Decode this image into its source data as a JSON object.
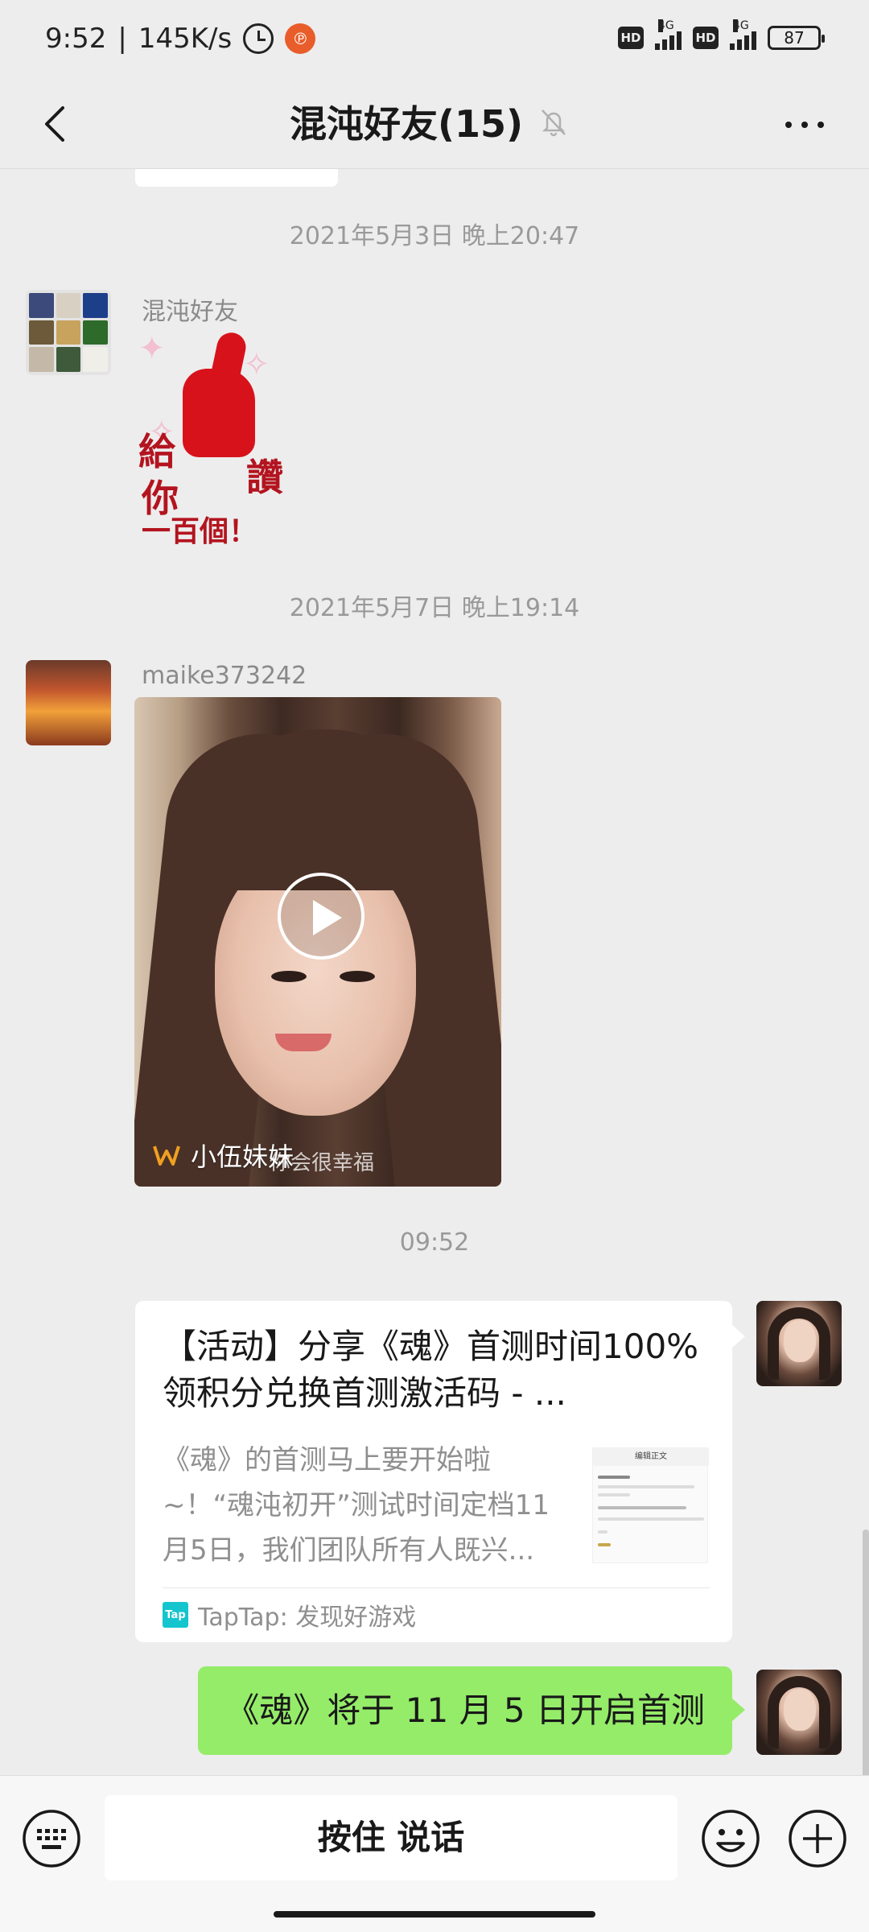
{
  "status_bar": {
    "time": "9:52",
    "speed": "145K/s",
    "app_badge": "℗",
    "hd1": "HD",
    "net1": "4G",
    "hd2": "HD",
    "net2": "4G",
    "battery": "87"
  },
  "nav": {
    "title": "混沌好友(15)"
  },
  "messages": {
    "ts1": "2021年5月3日 晚上20:47",
    "sender1": "混沌好友",
    "sticker": {
      "line1": "給",
      "line2": "你",
      "line3": "讚",
      "line4": "一百個！"
    },
    "ts2": "2021年5月7日 晚上19:14",
    "sender2": "maike373242",
    "video": {
      "brand": "小伍妹妹",
      "caption": "你会很幸福"
    },
    "ts3": "09:52",
    "card": {
      "title": "【活动】分享《魂》首测时间100%领积分兑换首测激活码 - ...",
      "desc": "《魂》的首测马上要开始啦~！“魂沌初开”测试时间定档11月5日，我们团队所有人既兴...",
      "thumb_header": "编辑正文",
      "source": "TapTap: 发现好游戏",
      "source_icon": "Tap"
    },
    "my_text": "《魂》将于 11 月 5 日开启首测"
  },
  "input_bar": {
    "voice_label": "按住 说话"
  },
  "colors": {
    "background": "#ededed",
    "green_bubble": "#95ec69",
    "tap_brand": "#15c5ce"
  }
}
